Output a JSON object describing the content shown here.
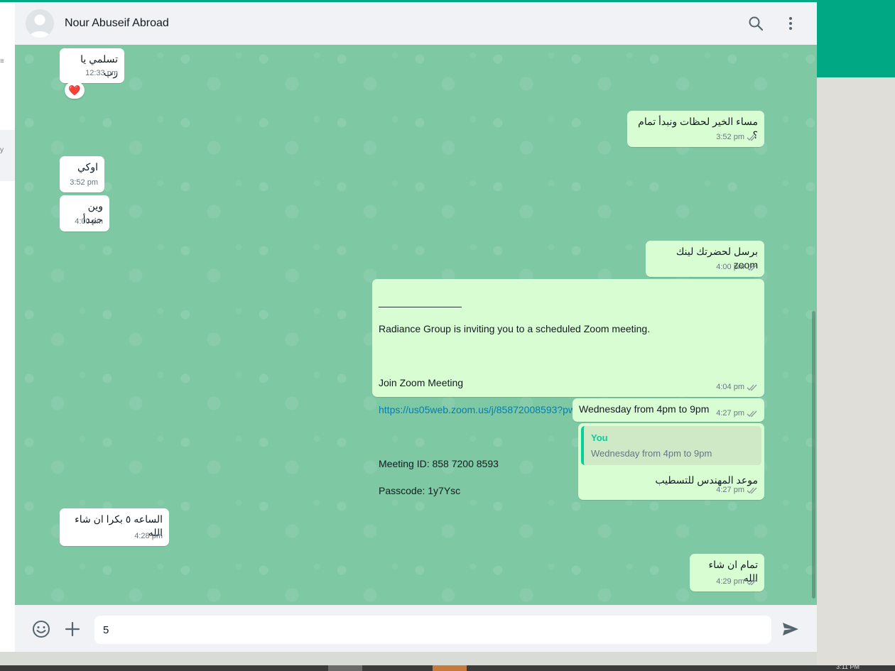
{
  "header": {
    "contact_name": "Nour Abuseif Abroad"
  },
  "icons": {
    "search": "search-icon",
    "menu": "kebab-menu-icon",
    "emoji": "emoji-icon",
    "attach": "plus-icon",
    "send": "send-icon",
    "ticks": "double-check-icon",
    "reaction": "heart-icon"
  },
  "colors": {
    "accent": "#00a884",
    "outgoing": "#d9fdd3",
    "incoming": "#ffffff",
    "link": "#027eb5"
  },
  "messages": [
    {
      "text": "تسلمي يا رب",
      "time": "12:33 pm",
      "reaction": "❤️"
    },
    {
      "text": "مساء الخير لحظات ونبدأ تمام ؟",
      "time": "3:52 pm"
    },
    {
      "text": "اوكي",
      "time": "3:52 pm"
    },
    {
      "text": "وين حنبدأ",
      "time": "4:00 pm"
    },
    {
      "text": "برسل لحضرتك لينك zoom",
      "time": "4:00 pm"
    },
    {
      "line": "_______________",
      "text1": "Radiance Group is inviting you to a scheduled Zoom meeting.",
      "text2": "Join Zoom Meeting",
      "link": "https://us05web.zoom.us/j/85872008593?pwd=txbIKZ1osp7udAWsb4CjPYuaus2EXb.1",
      "meeting_id": "Meeting ID: 858 7200 8593",
      "passcode": "Passcode: 1y7Ysc",
      "time": "4:04 pm"
    },
    {
      "text": "Wednesday from 4pm to 9pm",
      "time": "4:27 pm"
    },
    {
      "quote_author": "You",
      "quote_text": "Wednesday from 4pm to 9pm",
      "text": "موعد المهندس للتسطيب",
      "time": "4:27 pm"
    },
    {
      "text": "الساعه ٥ بكرا ان شاء الله",
      "time": "4:28 pm"
    },
    {
      "text": "تمام ان شاء الله",
      "time": "4:29 pm"
    }
  ],
  "composer": {
    "value": "5"
  },
  "taskbar": {
    "clock": "3:11 PM"
  }
}
